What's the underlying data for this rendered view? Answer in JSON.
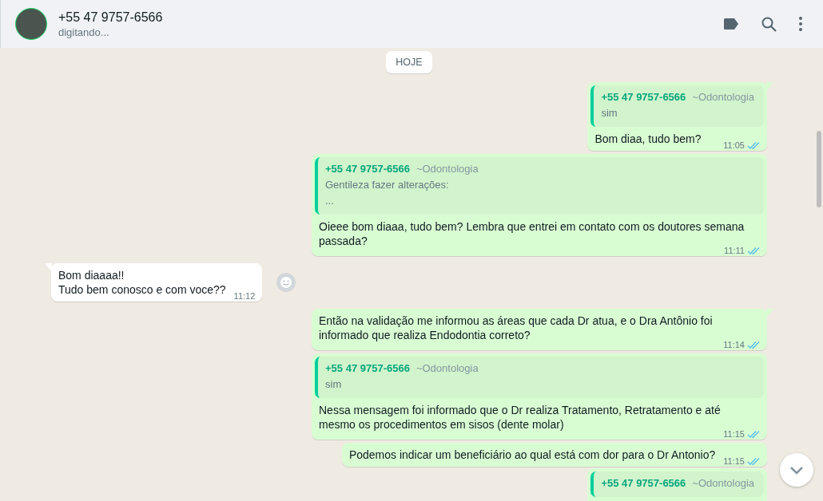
{
  "header": {
    "contact": "+55 47 9757-6566",
    "status": "digitando..."
  },
  "date_chip": "HOJE",
  "messages": [
    {
      "outgoing": true,
      "tail": true,
      "quote": {
        "author": "+55 47 9757-6566",
        "group": "~Odontologia",
        "lines": [
          "sim"
        ]
      },
      "text": "Bom diaa, tudo bem?",
      "time": "11:05",
      "read": true
    },
    {
      "outgoing": true,
      "tail": false,
      "quote": {
        "author": "+55 47 9757-6566",
        "group": "~Odontologia",
        "lines": [
          "Gentileza fazer alterações:",
          "..."
        ]
      },
      "text": "Oieee bom diaaa, tudo bem? Lembra que entrei em contato com os doutores semana passada?",
      "time": "11:11",
      "read": true
    },
    {
      "outgoing": false,
      "tail": true,
      "text": "Bom diaaaa!!\nTudo bem conosco e com voce??",
      "time": "11:12"
    },
    {
      "outgoing": true,
      "tail": true,
      "text": "Então na validação me informou as áreas que cada Dr atua, e o Dra Antônio foi informado que realiza Endodontia correto?",
      "time": "11:14",
      "read": true
    },
    {
      "outgoing": true,
      "tail": false,
      "quote": {
        "author": "+55 47 9757-6566",
        "group": "~Odontologia",
        "lines": [
          "sim"
        ]
      },
      "text": "Nessa mensagem foi informado que o Dr realiza Tratamento, Retratamento e até mesmo os procedimentos em sisos (dente molar)",
      "time": "11:15",
      "read": true
    },
    {
      "outgoing": true,
      "tail": false,
      "text": "Podemos indicar um beneficiário ao qual está com dor para o Dr Antonio?",
      "time": "11:15",
      "read": true
    },
    {
      "outgoing": true,
      "tail": false,
      "quote": {
        "author": "+55 47 9757-6566",
        "group": "~Odontologia"
      }
    }
  ]
}
